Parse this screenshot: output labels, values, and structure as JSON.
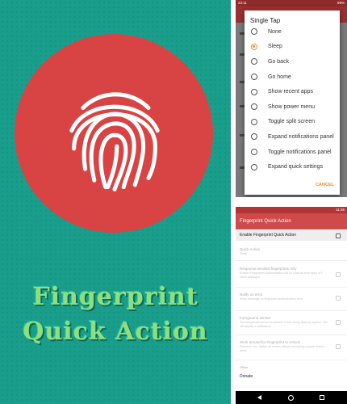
{
  "colors": {
    "banner_bg": "#1a9e8c",
    "circle": "#d84444",
    "title_text": "#8fe07a",
    "accent": "#f0902a",
    "app_bar": "#cf4a4a"
  },
  "banner": {
    "icon": "fingerprint-icon",
    "title_line1": "Fingerprint",
    "title_line2": "Quick Action"
  },
  "dialog_screen": {
    "status_time": "22:11",
    "status_right": "99%",
    "dialog": {
      "title": "Single Tap",
      "selected_option": "Sleep",
      "options": [
        "None",
        "Sleep",
        "Go back",
        "Go home",
        "Show recent apps",
        "Show power menu",
        "Toggle split screen",
        "Expand notifications panel",
        "Toggle notifications panel",
        "Expand quick settings"
      ],
      "cancel_label": "CANCEL"
    }
  },
  "settings_screen": {
    "status_time": "11:36",
    "app_title": "Fingerprint Quick Action",
    "enable_label": "Enable Fingerprint Quick Action",
    "prefs": [
      {
        "title": "Quick Action",
        "summary": "Sleep"
      },
      {
        "title": "Response enrolled fingerprints only",
        "summary": "Enable if fingerprint authentication will be used at other apps or F travel packages"
      },
      {
        "title": "Notify on error",
        "summary": "Show message on fingerprint authentication error"
      },
      {
        "title": "Foreground service",
        "summary": "The foreground service to prevent it from being killed by system; this will display a notification"
      },
      {
        "title": "Work around for Fingerprint to Unlock",
        "summary": "Requires root. Switch off screen without emulating a power button press"
      }
    ],
    "section_label": "Other",
    "donate_label": "Donate",
    "nav": [
      "back-icon",
      "home-icon",
      "recent-apps-icon"
    ]
  }
}
